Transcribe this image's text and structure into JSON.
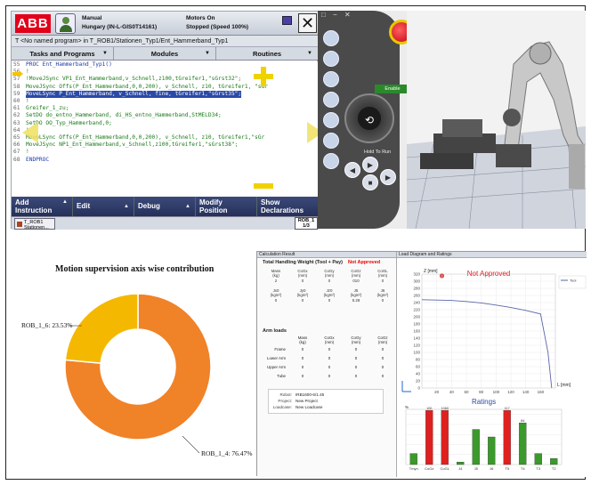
{
  "flexpendant": {
    "mode_label": "Manual",
    "controller_name": "Hungary (IN-L-GIS0T14161)",
    "motors_label": "Motors On",
    "speed_label": "Stopped (Speed 100%)",
    "close_glyph": "✕",
    "path": "T <No named program> in T_ROB1/Stationen_Typ1/Ent_Hammerband_Typ1",
    "menus": [
      "Tasks and Programs",
      "Modules",
      "Routines"
    ],
    "code_lines": [
      {
        "n": "55",
        "t": "PROC Ent_Hammerband_Typ1()",
        "k": "kw"
      },
      {
        "n": "56",
        "t": "  !",
        "k": "comment"
      },
      {
        "n": "57",
        "t": "  !MoveJSync VP1_Ent_Hammerband,v_Schnell,z100,tGreifer1,\"sGrst32\";",
        "k": "comment"
      },
      {
        "n": "58",
        "t": "  MoveJSync Offs(P_Ent_Hammerband,0,0,200), v_Schnell, z10, tGreifer1, \"sGr",
        "k": "comment"
      },
      {
        "n": "59",
        "t": "  MoveLSync P_Ent_Hammerband, v_Schnell, fine, tGreifer1,\"sGrst35\";",
        "k": "sel"
      },
      {
        "n": "60",
        "t": "  !",
        "k": "comment"
      },
      {
        "n": "61",
        "t": "  Greifer_1_zu;",
        "k": "comment"
      },
      {
        "n": "62",
        "t": "  SetDO do_entno_Hammerband, di_HS_entno_Hammerband,StMELD34;",
        "k": "comment"
      },
      {
        "n": "63",
        "t": "  SetDO OO_Typ_Hammerband,0;",
        "k": "comment"
      },
      {
        "n": "64",
        "t": "  !",
        "k": "comment"
      },
      {
        "n": "65",
        "t": "  MoveLSync Offs(P_Ent_Hammerband,0,0,200), v_Schnell, z10, tGreifer1,\"sGr",
        "k": "comment"
      },
      {
        "n": "66",
        "t": "  MoveJSync NP1_Ent_Hammerband,v_Schnell,z100,tGreifer1,\"sGrst38\";",
        "k": "comment"
      },
      {
        "n": "67",
        "t": "  !",
        "k": "comment"
      },
      {
        "n": "68",
        "t": "ENDPROC",
        "k": "kw"
      }
    ],
    "bottom_buttons": [
      {
        "l1": "Add",
        "l2": "Instruction"
      },
      {
        "l1": "Edit",
        "l2": ""
      },
      {
        "l1": "Debug",
        "l2": ""
      },
      {
        "l1": "Modify",
        "l2": "Position"
      },
      {
        "l1": "Show",
        "l2": "Declarations"
      }
    ],
    "task_button": {
      "l1": "T_ROB1",
      "l2": "Stationen..."
    },
    "rob_button": {
      "l1": "ROB_1",
      "l2": "1/3"
    }
  },
  "virtual_pendant": {
    "enable_label": "Enable",
    "hold_label": "Hold To Run"
  },
  "donut_chart": {
    "title": "Motion supervision axis wise contribution",
    "labels": [
      "ROB_1_6: 23.53%",
      "ROB_1_4: 76.47%"
    ]
  },
  "chart_data": [
    {
      "type": "pie",
      "title": "Motion supervision axis wise contribution",
      "categories": [
        "ROB_1_4",
        "ROB_1_6"
      ],
      "values": [
        76.47,
        23.53
      ],
      "colors": [
        "#f08228",
        "#f5b800"
      ],
      "donut": true
    },
    {
      "type": "line",
      "title": "Not Approved",
      "xlabel": "L [mm]",
      "ylabel": "Z [mm]",
      "xlim": [
        0,
        180
      ],
      "ylim": [
        0,
        320
      ],
      "x": [
        0,
        20,
        40,
        60,
        80,
        100,
        120,
        140,
        160,
        170,
        175
      ],
      "y": [
        248,
        247,
        246,
        243,
        239,
        233,
        226,
        218,
        208,
        100,
        0
      ],
      "line_color": "#5a66aa"
    },
    {
      "type": "bar",
      "title": "Ratings",
      "ylabel": "%",
      "ylim": [
        0,
        110
      ],
      "categories": [
        "Tmyn",
        "CoGz",
        "CoGL",
        "J4",
        "J5",
        "J6",
        "T5",
        "T4",
        "T3",
        "T2"
      ],
      "series": [
        {
          "name": "",
          "values": [
            22,
            108,
            108,
            5,
            70,
            55,
            108,
            83,
            22,
            12
          ],
          "colors": [
            "#3a9a2a",
            "#e02020",
            "#e02020",
            "#3a9a2a",
            "#3a9a2a",
            "#3a9a2a",
            "#e02020",
            "#3a9a2a",
            "#3a9a2a",
            "#3a9a2a"
          ]
        }
      ],
      "value_labels": [
        "",
        "100",
        "1060",
        "",
        "",
        "",
        "117",
        "84",
        "",
        ""
      ]
    }
  ],
  "calc": {
    "header": "Calculation Result",
    "sub": "Total Handling Weight (Tool + Pay)",
    "status": "Not Approved",
    "grid_rows": [
      [
        "Mass\n(kg)",
        "CoGx\n(mm)",
        "CoGy\n(mm)",
        "CoGz\n(mm)",
        "CoGL\n(mm)"
      ],
      [
        "2",
        "0",
        "0",
        "010",
        "0"
      ],
      [
        "Jx0\n(kgm²)",
        "Jy0\n(kgm²)",
        "Jz0\n(kgm²)",
        "J5\n(kgm²)",
        "J6\n(kgm²)"
      ],
      [
        "0",
        "0",
        "0",
        "5.28",
        "0"
      ]
    ],
    "arm_title": "Arm loads",
    "arm_head": [
      "",
      "Mass\n(kg)",
      "CoGx\n(mm)",
      "CoGy\n(mm)",
      "CoGz\n(mm)"
    ],
    "arm_rows": [
      [
        "Frame",
        "0",
        "0",
        "0",
        "0"
      ],
      [
        "Lower Arm",
        "0",
        "0",
        "0",
        "0"
      ],
      [
        "Upper Arm",
        "0",
        "0",
        "0",
        "0"
      ],
      [
        "Tube",
        "0",
        "0",
        "0",
        "0"
      ]
    ],
    "info": [
      {
        "k": "Robot:",
        "v": "IRB1600-6/1.45"
      },
      {
        "k": "Project:",
        "v": "New Project"
      },
      {
        "k": "Loadcase:",
        "v": "New Loadcase"
      }
    ],
    "diagram_header": "Load Diagram and Ratings",
    "ratings_title": "Ratings",
    "legend_tool": "Tool"
  }
}
